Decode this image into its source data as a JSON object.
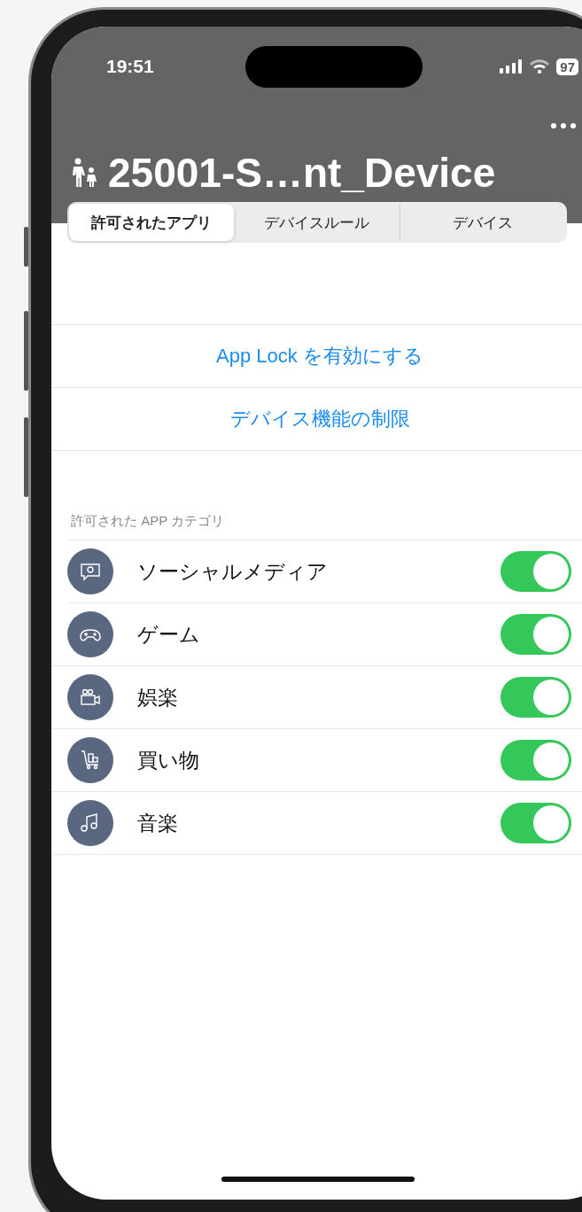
{
  "status_bar": {
    "time": "19:51",
    "battery": "97"
  },
  "nav": {
    "title": "25001-S…nt_Device"
  },
  "tabs": [
    {
      "label": "許可されたアプリ",
      "selected": true
    },
    {
      "label": "デバイスルール",
      "selected": false
    },
    {
      "label": "デバイス",
      "selected": false
    }
  ],
  "actions": [
    "App Lock を有効にする",
    "デバイス機能の制限"
  ],
  "section_label": "許可された APP カテゴリ",
  "categories": [
    {
      "name": "ソーシャルメディア",
      "kind": "social",
      "on": true
    },
    {
      "name": "ゲーム",
      "kind": "game",
      "on": true
    },
    {
      "name": "娯楽",
      "kind": "entertainment",
      "on": true
    },
    {
      "name": "買い物",
      "kind": "shopping",
      "on": true
    },
    {
      "name": "音楽",
      "kind": "music",
      "on": true
    }
  ]
}
